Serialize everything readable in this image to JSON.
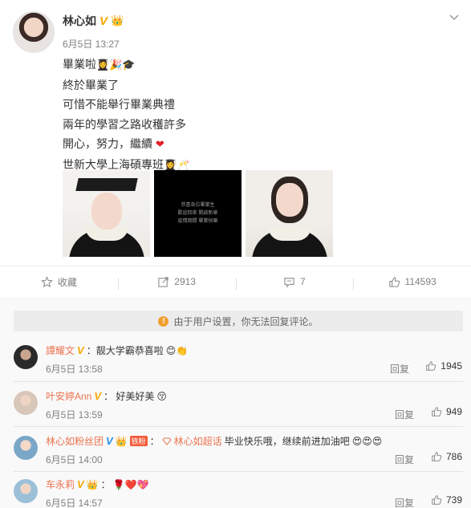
{
  "post": {
    "author": "林心如",
    "time": "6月5日 13:27",
    "lines": [
      "畢業啦",
      "終於畢業了",
      "可惜不能舉行畢業典禮",
      "兩年的學習之路收穫許多",
      "開心，努力，繼續",
      "世新大學上海碩專班"
    ],
    "image2_text": [
      "恭喜各位畢業生",
      "歡迎回來 開啟新章",
      "疫情期間 畢業快樂"
    ]
  },
  "actions": {
    "favorite_label": "收藏",
    "share_count": "2913",
    "comment_count": "7",
    "like_count": "114593"
  },
  "notice": {
    "text": "由于用户设置，你无法回复评论。"
  },
  "comments": [
    {
      "user": "譚耀文",
      "text": "：靓大学霸恭喜啦",
      "time": "6月5日 13:58",
      "reply": "回复",
      "likes": "1945"
    },
    {
      "user": "叶安婷Ann",
      "text": "： 好美好美",
      "time": "6月5日 13:59",
      "reply": "回复",
      "likes": "949"
    },
    {
      "user": "林心如粉丝团",
      "badge": "铁粉",
      "super_label": "林心如超话",
      "text": "毕业快乐哦，继续前进加油吧",
      "time": "6月5日 14:00",
      "reply": "回复",
      "likes": "786"
    },
    {
      "user": "车永莉",
      "text": "：",
      "time": "6月5日 14:57",
      "reply": "回复",
      "likes": "739"
    }
  ],
  "colors": {
    "username": "#eb7350",
    "verified_gold": "#f7a800",
    "verified_blue": "#2a8fe6",
    "notice_icon": "#f0a030"
  },
  "icons": [
    "star-icon",
    "share-icon",
    "comment-icon",
    "like-icon",
    "chevron-down-icon",
    "info-icon"
  ]
}
